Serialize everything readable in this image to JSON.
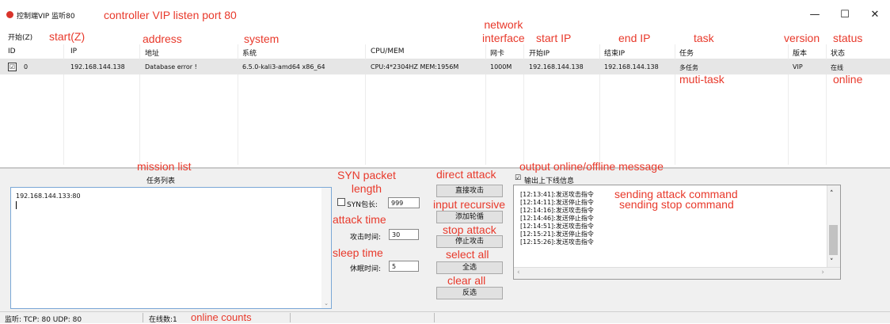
{
  "window": {
    "title": "控制端VIP 监听80",
    "controls": {
      "minimize": "—",
      "maximize": "☐",
      "close": "✕"
    }
  },
  "menu": {
    "start": "开始(Z)"
  },
  "table": {
    "headers": [
      "ID",
      "IP",
      "地址",
      "系统",
      "CPU/MEM",
      "网卡",
      "开始IP",
      "结束IP",
      "任务",
      "版本",
      "状态"
    ],
    "rows": [
      {
        "checked": "☑",
        "id": "0",
        "ip": "192.168.144.138",
        "address": "Database error !",
        "system": "6.5.0-kali3-amd64 x86_64",
        "cpu_mem": "CPU:4*2304HZ MEM:1956M",
        "nic": "1000M",
        "start_ip": "192.168.144.138",
        "end_ip": "192.168.144.138",
        "task": "多任务",
        "version": "VIP",
        "status": "在线"
      }
    ]
  },
  "mission_list": {
    "title": "任务列表",
    "content": "192.168.144.133:80"
  },
  "options": {
    "syn_label": "SYN包长:",
    "syn_value": "999",
    "attack_time_label": "攻击时间:",
    "attack_time_value": "30",
    "sleep_time_label": "休眠时间:",
    "sleep_time_value": "5"
  },
  "buttons": {
    "direct_attack": "直接攻击",
    "add_recursive": "添加轮循",
    "stop_attack": "停止攻击",
    "select_all": "全选",
    "invert_select": "反选"
  },
  "log": {
    "checkbox_label": "输出上下线信息",
    "checked": "☑",
    "lines": [
      "[12:13:41]:发送攻击指令",
      "[12:14:11]:发送停止指令",
      "[12:14:16]:发送攻击指令",
      "[12:14:46]:发送停止指令",
      "[12:14:51]:发送攻击指令",
      "[12:15:21]:发送停止指令",
      "[12:15:26]:发送攻击指令"
    ]
  },
  "statusbar": {
    "listen": "监听: TCP: 80 UDP: 80",
    "online": "在线数:1"
  },
  "annotations": {
    "title": "controller VIP  listen port 80",
    "start": "start(Z)",
    "address": "address",
    "system": "system",
    "network_interface": "network\ninterface",
    "start_ip": "start IP",
    "end_ip": "end IP",
    "task": "task",
    "version": "version",
    "status": "status",
    "multitask": "muti-task",
    "online": "online",
    "mission_list": "mission list",
    "syn_packet_length": "SYN packet\nlength",
    "attack_time": "attack time",
    "sleep_time": "sleep time",
    "direct_attack": "direct attack",
    "input_recursive": "input recursive",
    "stop_attack": "stop attack",
    "select_all": "select all",
    "clear_all": "clear all",
    "output_message": "output online/offline message",
    "sending_attack": "sending attack command",
    "sending_stop": "sending stop command",
    "online_counts": "online counts"
  },
  "colors": {
    "annotation": "#e8392b",
    "row_selected": "#e6e6e6",
    "panel": "#f0f0f0",
    "textbox_border": "#7aa7d6"
  }
}
